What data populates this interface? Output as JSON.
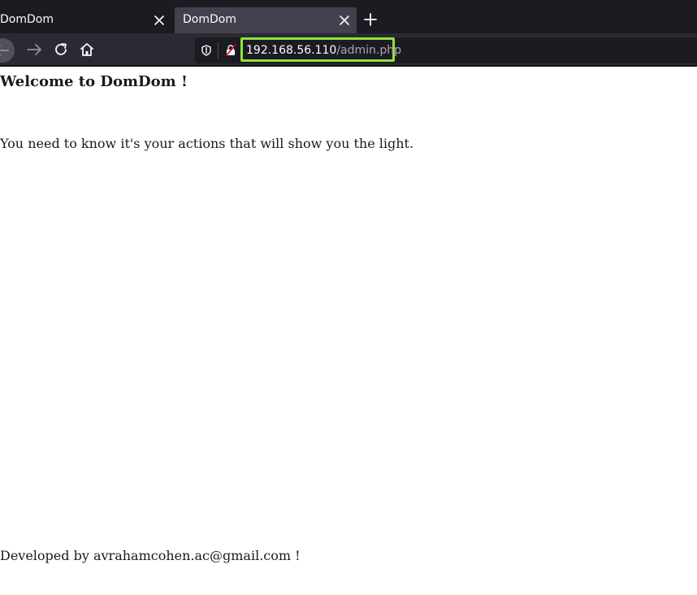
{
  "browser": {
    "tabs": [
      {
        "title": "DomDom",
        "active": false
      },
      {
        "title": "DomDom",
        "active": true
      }
    ],
    "icons": {
      "tab_close": "close-icon",
      "new_tab": "plus-icon",
      "back": "arrow-left-icon",
      "forward": "arrow-right-icon",
      "reload": "reload-icon",
      "home": "home-icon",
      "tracking": "shield-icon",
      "connection": "insecure-lock-icon"
    },
    "url": {
      "host": "192.168.56.110",
      "path": "/admin.php"
    },
    "colors": {
      "chrome_dark": "#1c1b22",
      "active_tab": "#42414d",
      "url_highlight": "#8de33b"
    }
  },
  "page": {
    "heading": "Welcome to DomDom !",
    "message": "You need to know it's your actions that will show you the light.",
    "footer": "Developed by avrahamcohen.ac@gmail.com !"
  }
}
